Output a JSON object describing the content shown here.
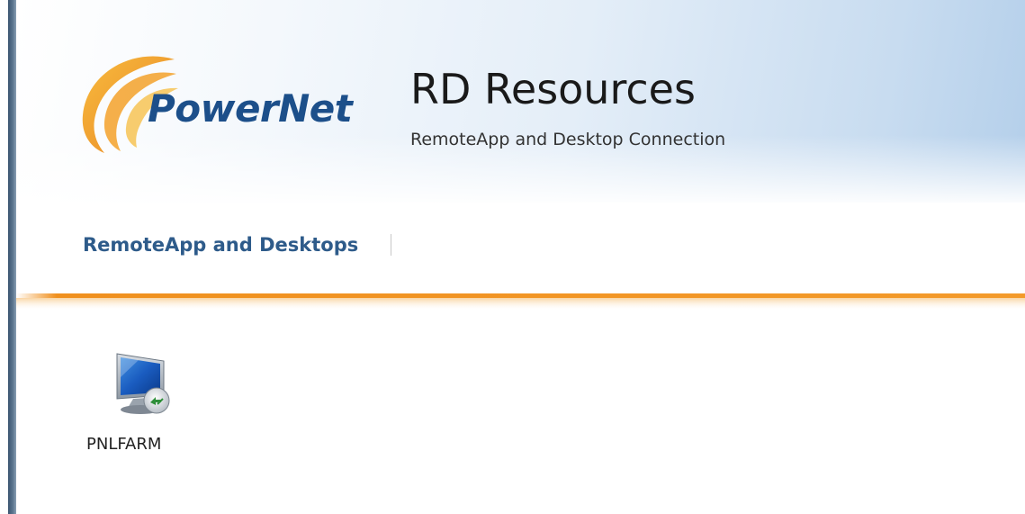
{
  "brand": {
    "logo_text": "PowerNet"
  },
  "header": {
    "title": "RD Resources",
    "subtitle": "RemoteApp and Desktop Connection"
  },
  "nav": {
    "tabs": [
      {
        "label": "RemoteApp and Desktops",
        "selected": true
      }
    ]
  },
  "resources": [
    {
      "label": "PNLFARM",
      "icon": "remote-desktop-icon"
    }
  ],
  "colors": {
    "nav_text": "#2e5b8a",
    "logo_text": "#1c4f8a",
    "accent_orange": "#f0901e",
    "header_blue": "#b4cfea"
  }
}
